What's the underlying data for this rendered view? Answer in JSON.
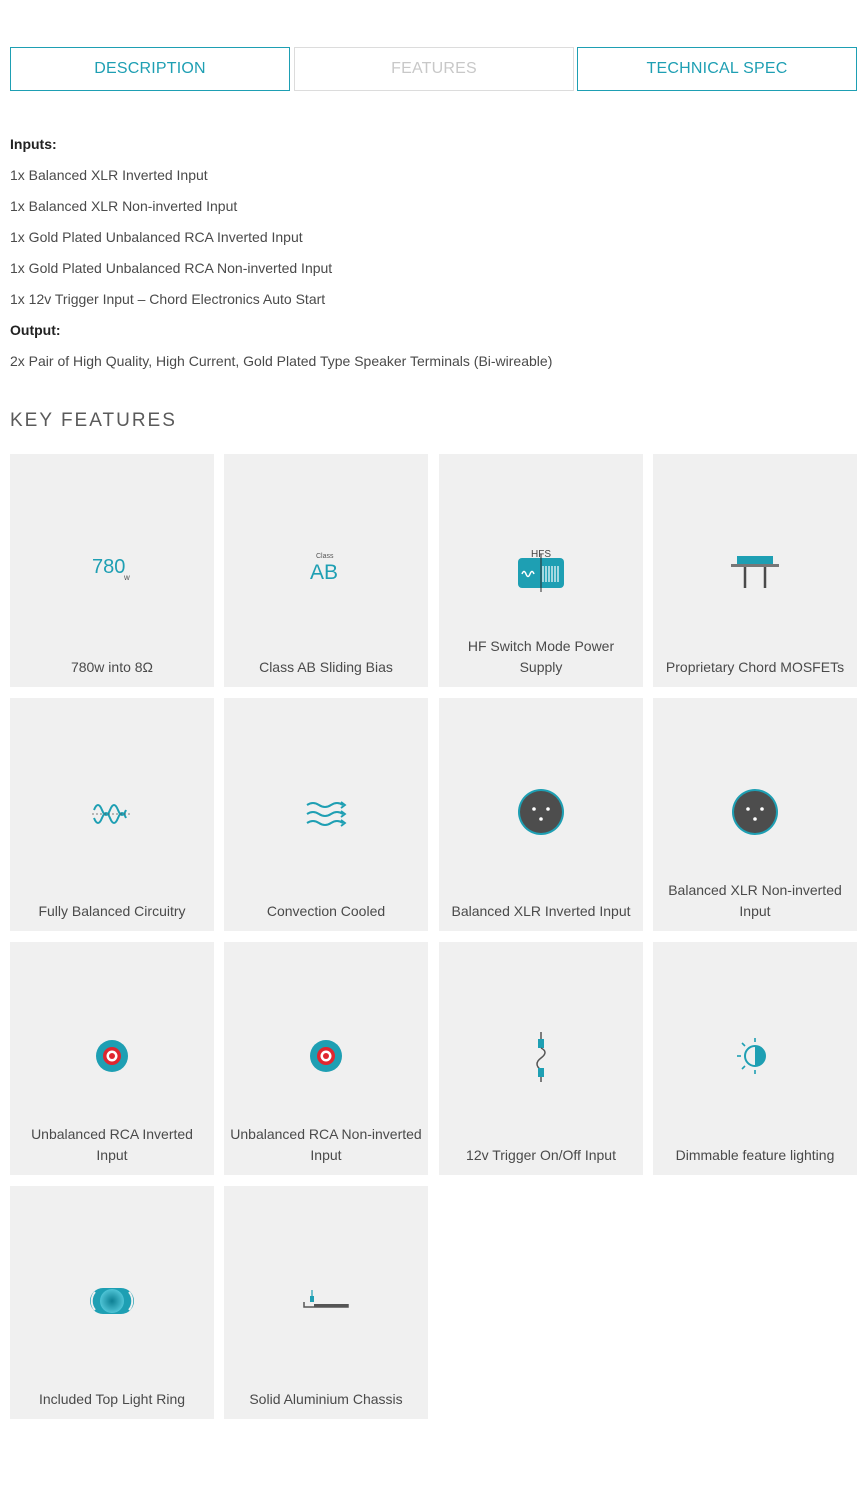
{
  "tabs": [
    {
      "label": "DESCRIPTION",
      "state": "active"
    },
    {
      "label": "FEATURES",
      "state": "inactive"
    },
    {
      "label": "TECHNICAL SPEC",
      "state": "active"
    }
  ],
  "specs": [
    {
      "text": "Inputs:",
      "kind": "head"
    },
    {
      "text": "1x Balanced XLR Inverted Input",
      "kind": "item"
    },
    {
      "text": "1x Balanced XLR Non-inverted Input",
      "kind": "item"
    },
    {
      "text": "1x Gold Plated Unbalanced RCA Inverted Input",
      "kind": "item"
    },
    {
      "text": "1x Gold Plated Unbalanced RCA Non-inverted Input",
      "kind": "item"
    },
    {
      "text": "1x 12v Trigger Input – Chord Electronics Auto Start",
      "kind": "item"
    },
    {
      "text": "Output:",
      "kind": "head"
    },
    {
      "text": "2x Pair of High Quality, High Current, Gold Plated Type Speaker Terminals (Bi-wireable)",
      "kind": "item"
    }
  ],
  "key_features_title": "KEY FEATURES",
  "features": [
    {
      "label": "780w into 8Ω",
      "icon": "780w-icon",
      "icon_text": "780",
      "icon_sub": "w"
    },
    {
      "label": "Class AB Sliding Bias",
      "icon": "class-ab-icon",
      "icon_text": "AB",
      "icon_sub": "Class"
    },
    {
      "label": "HF Switch Mode Power Supply",
      "icon": "hfs-icon",
      "icon_text": "HFS"
    },
    {
      "label": "Proprietary Chord MOSFETs",
      "icon": "mosfet-icon"
    },
    {
      "label": "Fully Balanced Circuitry",
      "icon": "balanced-wave-icon"
    },
    {
      "label": "Convection Cooled",
      "icon": "airflow-icon"
    },
    {
      "label": "Balanced XLR Inverted Input",
      "icon": "xlr-socket-icon"
    },
    {
      "label": "Balanced XLR Non-inverted Input",
      "icon": "xlr-socket-icon"
    },
    {
      "label": "Unbalanced RCA Inverted Input",
      "icon": "rca-socket-icon"
    },
    {
      "label": "Unbalanced RCA Non-inverted Input",
      "icon": "rca-socket-icon"
    },
    {
      "label": "12v Trigger On/Off Input",
      "icon": "trigger-cable-icon"
    },
    {
      "label": "Dimmable feature lighting",
      "icon": "dimmer-icon"
    },
    {
      "label": "Included Top Light Ring",
      "icon": "light-ring-icon"
    },
    {
      "label": "Solid Aluminium Chassis",
      "icon": "chassis-icon"
    }
  ],
  "colors": {
    "accent": "#1e9fb3",
    "card_bg": "#f0f0f0",
    "socket": "#4d4d4d",
    "rca_red": "#e0262f"
  }
}
